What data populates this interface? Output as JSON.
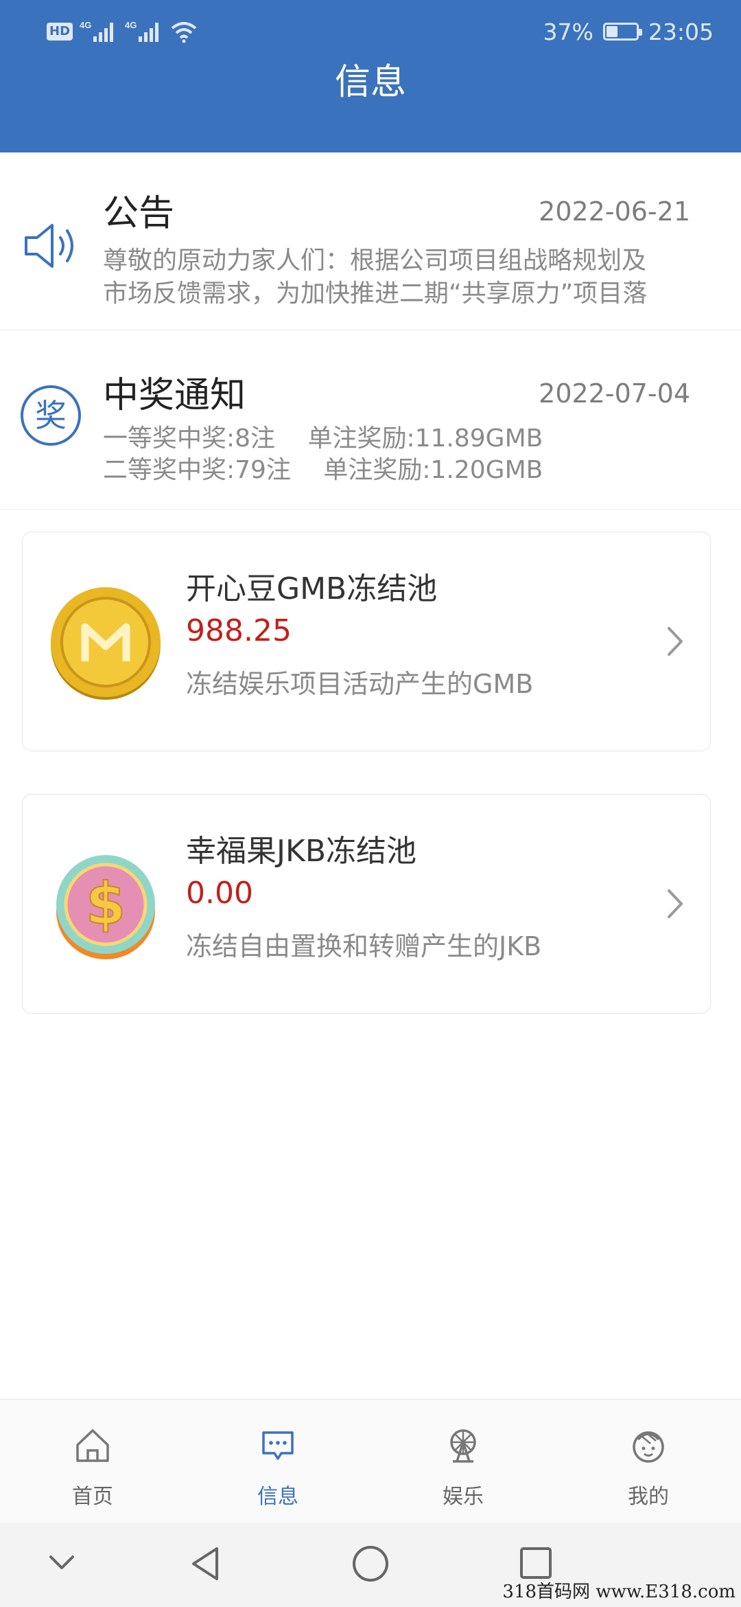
{
  "status_bar": {
    "hd_label": "HD",
    "net1": "4G",
    "net2": "4G",
    "battery_percent_text": "37%",
    "battery_level": 0.37,
    "time": "23:05"
  },
  "header": {
    "title": "信息"
  },
  "announcement": {
    "icon": "speaker-icon",
    "title": "公告",
    "date": "2022-06-21",
    "line1": "尊敬的原动力家人们：根据公司项目组战略规划及",
    "line2": "市场反馈需求，为加快推进二期“共享原力”项目落"
  },
  "prize": {
    "icon": "prize-badge-icon",
    "icon_char": "奖",
    "title": "中奖通知",
    "date": "2022-07-04",
    "line1": "一等奖中奖:8注　 单注奖励:11.89GMB",
    "line2": "二等奖中奖:79注　 单注奖励:1.20GMB"
  },
  "pools": [
    {
      "icon": "gold-coin-icon",
      "title": "开心豆GMB冻结池",
      "amount": "988.25",
      "desc": "冻结娱乐项目活动产生的GMB"
    },
    {
      "icon": "dollar-coin-icon",
      "title": "幸福果JKB冻结池",
      "amount": "0.00",
      "desc": "冻结自由置换和转赠产生的JKB"
    }
  ],
  "tabs": [
    {
      "label": "首页",
      "icon": "home-icon",
      "active": false
    },
    {
      "label": "信息",
      "icon": "message-icon",
      "active": true
    },
    {
      "label": "娱乐",
      "icon": "ferris-wheel-icon",
      "active": false
    },
    {
      "label": "我的",
      "icon": "profile-face-icon",
      "active": false
    }
  ],
  "watermark": "318首码网 www.E318.com",
  "colors": {
    "header": "#3a72bd",
    "accent": "#3a72bd",
    "amount": "#c1201a"
  }
}
